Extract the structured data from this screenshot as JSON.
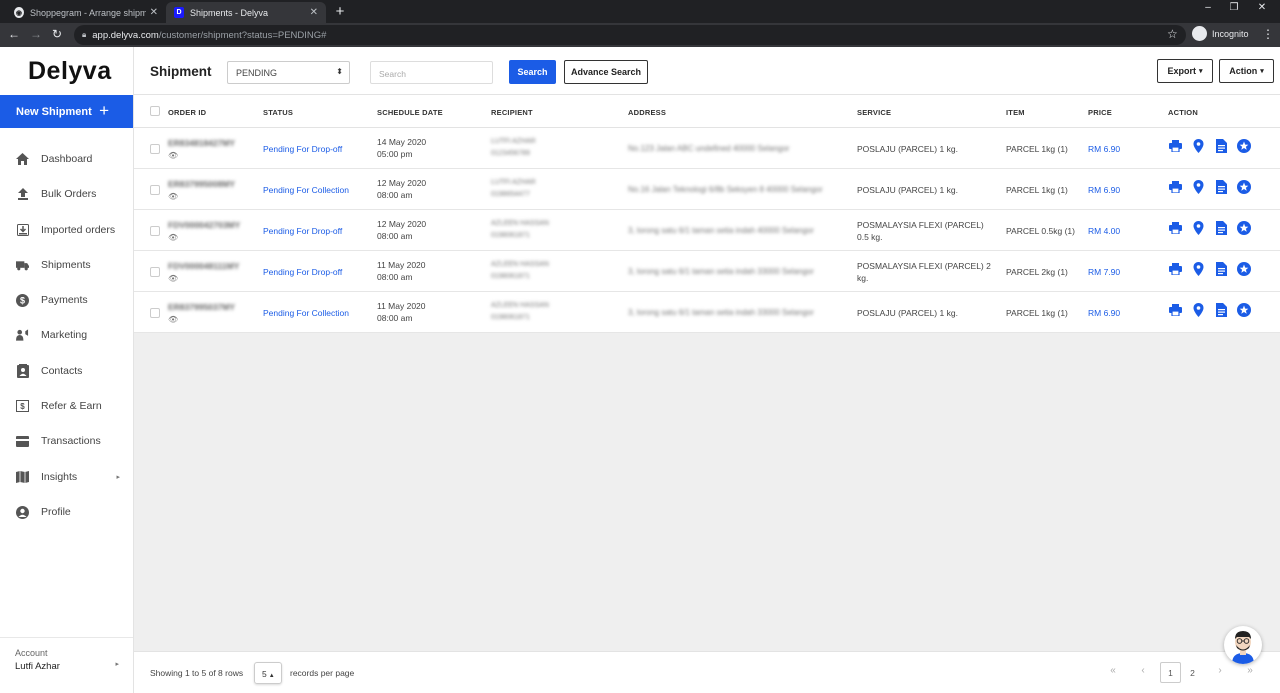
{
  "browser": {
    "tabs": [
      {
        "title": "Shoppegram - Arrange shipment",
        "active": false
      },
      {
        "title": "Shipments - Delyva",
        "active": true,
        "favicon_letter": "D"
      }
    ],
    "url_host": "app.delyva.com",
    "url_path": "/customer/shipment?status=PENDING#",
    "profile_label": "Incognito"
  },
  "sidebar": {
    "logo": "Delyva",
    "new_shipment": "New Shipment",
    "items": [
      {
        "label": "Dashboard",
        "icon": "home-icon"
      },
      {
        "label": "Bulk Orders",
        "icon": "upload-icon"
      },
      {
        "label": "Imported orders",
        "icon": "import-icon"
      },
      {
        "label": "Shipments",
        "icon": "truck-icon"
      },
      {
        "label": "Payments",
        "icon": "dollar-icon"
      },
      {
        "label": "Marketing",
        "icon": "megaphone-icon"
      },
      {
        "label": "Contacts",
        "icon": "contacts-icon"
      },
      {
        "label": "Refer & Earn",
        "icon": "money-icon"
      },
      {
        "label": "Transactions",
        "icon": "card-icon"
      },
      {
        "label": "Insights",
        "icon": "map-icon"
      },
      {
        "label": "Profile",
        "icon": "profile-icon"
      }
    ],
    "account_label": "Account",
    "account_name": "Lutfi Azhar"
  },
  "header": {
    "title": "Shipment",
    "status_value": "PENDING",
    "search_placeholder": "Search",
    "search_button": "Search",
    "advance_search_button": "Advance Search",
    "export_button": "Export",
    "action_button": "Action"
  },
  "table": {
    "columns": [
      "ORDER ID",
      "STATUS",
      "SCHEDULE DATE",
      "RECIPIENT",
      "ADDRESS",
      "SERVICE",
      "ITEM",
      "PRICE",
      "ACTION"
    ],
    "rows": [
      {
        "order_id": "ER834818427MY",
        "status": "Pending For Drop-off",
        "date": "14 May 2020",
        "time": "05:00 pm",
        "recipient_name": "LUTFI AZHAR",
        "recipient_phone": "0123456789",
        "address": "No.123 Jalan ABC undefined 40000 Selangor",
        "service": "POSLAJU (PARCEL) 1 kg.",
        "item": "PARCEL 1kg (1)",
        "price": "RM 6.90"
      },
      {
        "order_id": "ER837995008MY",
        "status": "Pending For Collection",
        "date": "12 May 2020",
        "time": "08:00 am",
        "recipient_name": "LUTFI AZHAR",
        "recipient_phone": "0198654477",
        "address": "No.16 Jalan Teknologi 6/8b Seksyen 8 40000 Selangor",
        "service": "POSLAJU (PARCEL) 1 kg.",
        "item": "PARCEL 1kg (1)",
        "price": "RM 6.90"
      },
      {
        "order_id": "FDV000042703MY",
        "status": "Pending For Drop-off",
        "date": "12 May 2020",
        "time": "08:00 am",
        "recipient_name": "AZLEEN HASSAN",
        "recipient_phone": "0198061871",
        "address": "3, lorong satu 6/1 taman setia indah 40000 Selangor",
        "service": "POSMALAYSIA FLEXI (PARCEL) 0.5 kg.",
        "item": "PARCEL 0.5kg (1)",
        "price": "RM 4.00"
      },
      {
        "order_id": "FDV000048111MY",
        "status": "Pending For Drop-off",
        "date": "11 May 2020",
        "time": "08:00 am",
        "recipient_name": "AZLEEN HASSAN",
        "recipient_phone": "0198061871",
        "address": "3, lorong satu 6/1 taman setia indah 33000 Selangor",
        "service": "POSMALAYSIA FLEXI (PARCEL) 2 kg.",
        "item": "PARCEL 2kg (1)",
        "price": "RM 7.90"
      },
      {
        "order_id": "ER837995037MY",
        "status": "Pending For Collection",
        "date": "11 May 2020",
        "time": "08:00 am",
        "recipient_name": "AZLEEN HASSAN",
        "recipient_phone": "0198061871",
        "address": "3, lorong satu 6/1 taman setia indah 33000 Selangor",
        "service": "POSLAJU (PARCEL) 1 kg.",
        "item": "PARCEL 1kg (1)",
        "price": "RM 6.90"
      }
    ],
    "action_icons": [
      "print-icon",
      "location-pin-icon",
      "document-icon",
      "star-badge-icon"
    ]
  },
  "footer": {
    "showing": "Showing 1 to 5 of 8 rows",
    "per_page": "5",
    "records_per_page": "records per page",
    "pages": [
      "1",
      "2"
    ],
    "current_page": "1"
  },
  "colors": {
    "accent": "#1b5ce6",
    "chrome_dark": "#202124",
    "content_bg": "#efefef"
  }
}
